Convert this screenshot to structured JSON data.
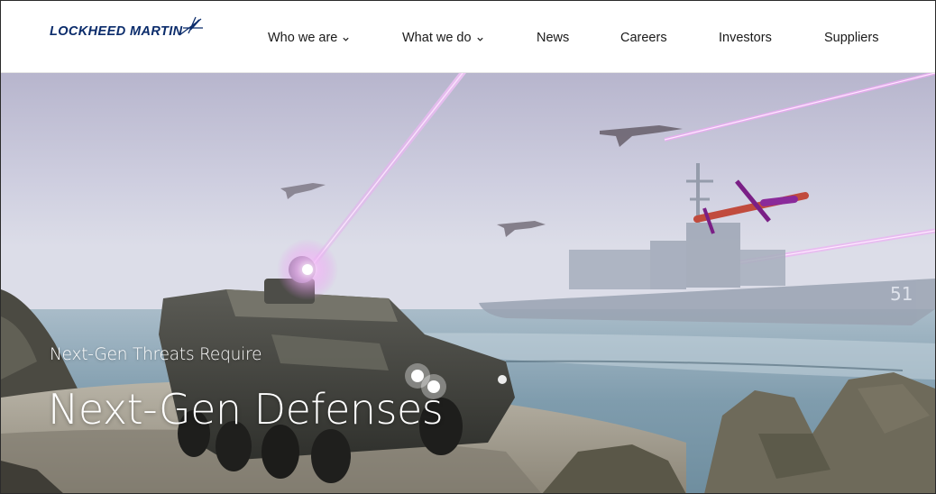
{
  "brand": {
    "name": "LOCKHEED MARTIN"
  },
  "nav": [
    {
      "label": "Who we are",
      "has_dropdown": true
    },
    {
      "label": "What we do",
      "has_dropdown": true
    },
    {
      "label": "News",
      "has_dropdown": false
    },
    {
      "label": "Careers",
      "has_dropdown": false
    },
    {
      "label": "Investors",
      "has_dropdown": false
    },
    {
      "label": "Suppliers",
      "has_dropdown": false
    }
  ],
  "hero": {
    "subtitle": "Next-Gen Threats Require",
    "title": "Next-Gen Defenses",
    "ship_hull_number": "51"
  },
  "colors": {
    "brand_navy": "#0b2c6b",
    "laser": "#e98bf2",
    "sky": "#c9c9dc",
    "sea": "#8fa9b8"
  }
}
